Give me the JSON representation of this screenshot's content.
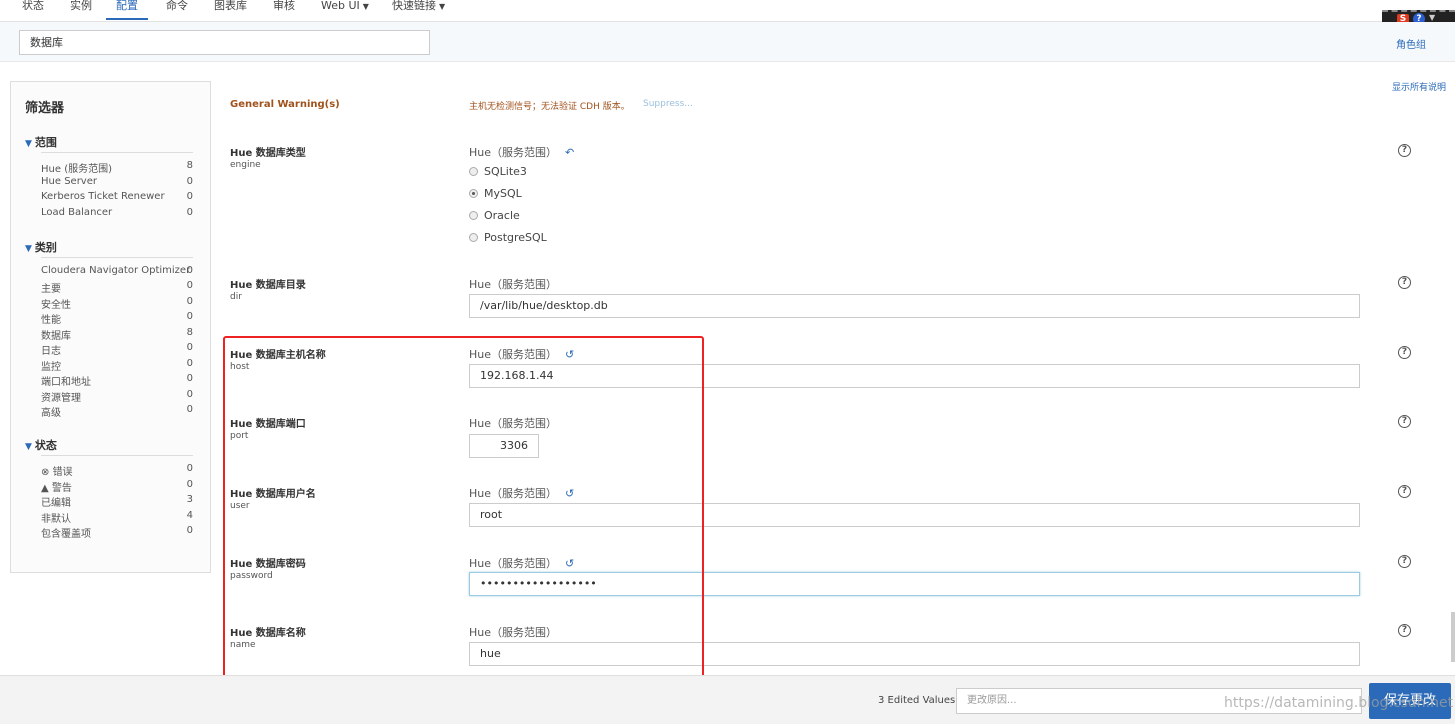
{
  "nav": {
    "tabs": [
      {
        "label": "状态"
      },
      {
        "label": "实例"
      },
      {
        "label": "配置"
      },
      {
        "label": "命令"
      },
      {
        "label": "图表库"
      },
      {
        "label": "审核"
      },
      {
        "label": "Web UI"
      },
      {
        "label": "快速链接"
      }
    ],
    "active_tab": "配置"
  },
  "toolbar": {
    "s_label": "S",
    "help_label": "?"
  },
  "search": {
    "value": "数据库"
  },
  "header": {
    "role_group": "角色组",
    "show_all": "显示所有说明"
  },
  "filter": {
    "title": "筛选器",
    "sections": [
      {
        "title": "范围",
        "items": [
          {
            "label": "Hue (服务范围)",
            "count": "8"
          },
          {
            "label": "Hue Server",
            "count": "0"
          },
          {
            "label": "Kerberos Ticket Renewer",
            "count": "0"
          },
          {
            "label": "Load Balancer",
            "count": "0"
          }
        ]
      },
      {
        "title": "类别",
        "items": [
          {
            "label": "Cloudera Navigator Optimizer",
            "count": "0"
          },
          {
            "label": "主要",
            "count": "0"
          },
          {
            "label": "安全性",
            "count": "0"
          },
          {
            "label": "性能",
            "count": "0"
          },
          {
            "label": "数据库",
            "count": "8"
          },
          {
            "label": "日志",
            "count": "0"
          },
          {
            "label": "监控",
            "count": "0"
          },
          {
            "label": "端口和地址",
            "count": "0"
          },
          {
            "label": "资源管理",
            "count": "0"
          },
          {
            "label": "高级",
            "count": "0"
          }
        ]
      },
      {
        "title": "状态",
        "items": [
          {
            "label": "错误",
            "count": "0"
          },
          {
            "label": "警告",
            "count": "0"
          },
          {
            "label": "已编辑",
            "count": "3"
          },
          {
            "label": "非默认",
            "count": "4"
          },
          {
            "label": "包含覆盖项",
            "count": "0"
          }
        ]
      }
    ]
  },
  "warning": {
    "title": "General Warning(s)",
    "message": "主机无检测信号；无法验证 CDH 版本。",
    "suppress": "Suppress..."
  },
  "properties": [
    {
      "title": "Hue 数据库类型",
      "key": "engine",
      "scope": "Hue（服务范围）",
      "options": [
        "SQLite3",
        "MySQL",
        "Oracle",
        "PostgreSQL"
      ],
      "selected": "MySQL"
    },
    {
      "title": "Hue 数据库目录",
      "key": "dir",
      "scope": "Hue（服务范围）",
      "value": "/var/lib/hue/desktop.db"
    },
    {
      "title": "Hue 数据库主机名称",
      "key": "host",
      "scope": "Hue（服务范围）",
      "value": "192.168.1.44"
    },
    {
      "title": "Hue 数据库端口",
      "key": "port",
      "scope": "Hue（服务范围）",
      "value": "3306"
    },
    {
      "title": "Hue 数据库用户名",
      "key": "user",
      "scope": "Hue（服务范围）",
      "value": "root"
    },
    {
      "title": "Hue 数据库密码",
      "key": "password",
      "scope": "Hue（服务范围）",
      "value": "••••••••••••••••••"
    },
    {
      "title": "Hue 数据库名称",
      "key": "name",
      "scope": "Hue（服务范围）",
      "value": "hue"
    }
  ],
  "footer": {
    "edited": "3 Edited Values",
    "reason_placeholder": "更改原因...",
    "save_label": "保存更改"
  },
  "watermark": "https://datamining.blog.csdn.net",
  "colors": {
    "accent": "#2a6ab8",
    "warning": "#a0521c",
    "highlight_box": "#e22222"
  }
}
